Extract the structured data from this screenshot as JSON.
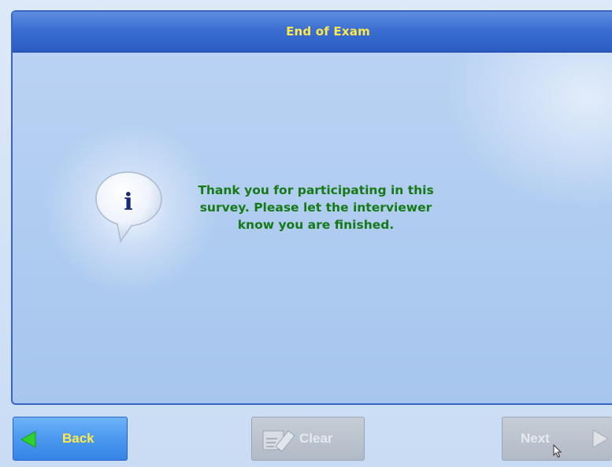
{
  "dialog": {
    "title": "End of Exam",
    "message_lines": [
      "Thank you for participating in this",
      "survey. Please let the interviewer",
      "know you are finished."
    ],
    "icon": "info-speech-bubble-icon",
    "icon_glyph": "i"
  },
  "buttons": {
    "back": {
      "label": "Back",
      "icon": "arrow-left-icon",
      "enabled": true
    },
    "clear": {
      "label": "Clear",
      "icon": "eraser-icon",
      "enabled": false
    },
    "next": {
      "label": "Next",
      "icon": "arrow-right-icon",
      "enabled": false
    }
  },
  "colors": {
    "title_bar": "#3c6fd1",
    "title_text": "#ffe94a",
    "message_text": "#157a16",
    "back_arrow": "#2fd12f",
    "disabled_button": "#b1bac6"
  }
}
